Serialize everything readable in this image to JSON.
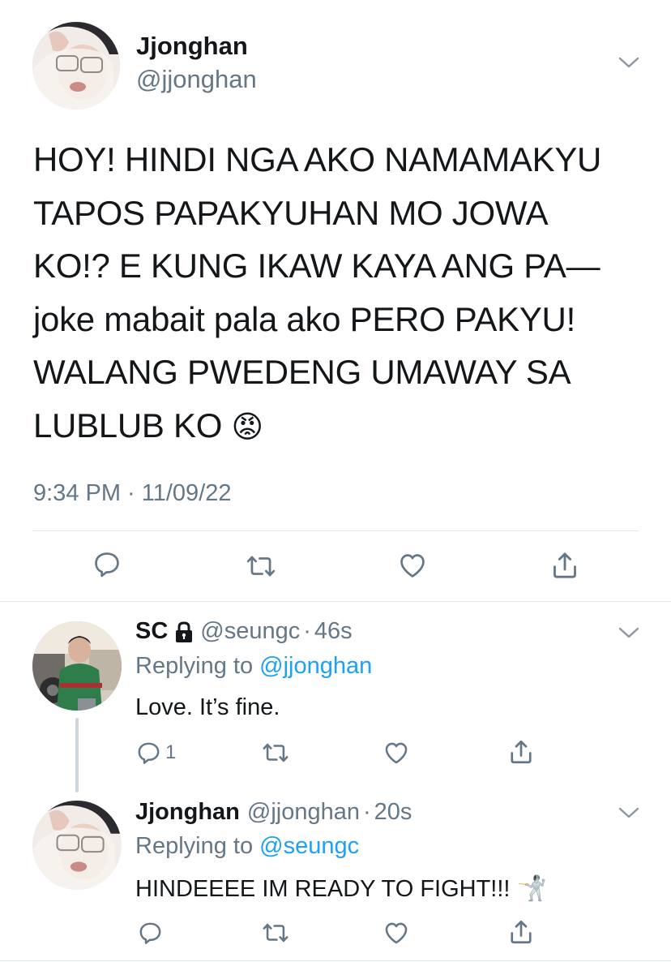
{
  "main_tweet": {
    "author_name": "Jjonghan",
    "author_handle": "@jjonghan",
    "text_lines": [
      "HOY! HINDI NGA AKO NAMAMAKYU",
      "TAPOS PAPAKYUHAN MO JOWA",
      "KO!? E KUNG IKAW KAYA ANG PA—",
      "joke mabait pala ako PERO PAKYU!",
      "WALANG PWEDENG UMAWAY SA",
      "LUBLUB KO"
    ],
    "emoji": "😡",
    "timestamp": "9:34 PM · 11/09/22",
    "actions": [
      "reply-icon",
      "retweet-icon",
      "like-icon",
      "share-icon"
    ]
  },
  "replies": [
    {
      "author_name": "SC",
      "locked": true,
      "author_handle": "@seungc",
      "time": "46s",
      "replying_label": "Replying to",
      "replying_to": "@jjonghan",
      "text": "Love. It’s fine.",
      "reply_count": "1"
    },
    {
      "author_name": "Jjonghan",
      "locked": false,
      "author_handle": "@jjonghan",
      "time": "20s",
      "replying_label": "Replying to",
      "replying_to": "@seungc",
      "text": "HINDEEEE IM READY TO FIGHT!!!",
      "emoji": "🤺",
      "reply_count": ""
    }
  ],
  "colors": {
    "text": "#14171a",
    "secondary": "#657786",
    "link": "#1da1f2",
    "divider": "#e1e8ed",
    "icon": "#657786"
  }
}
